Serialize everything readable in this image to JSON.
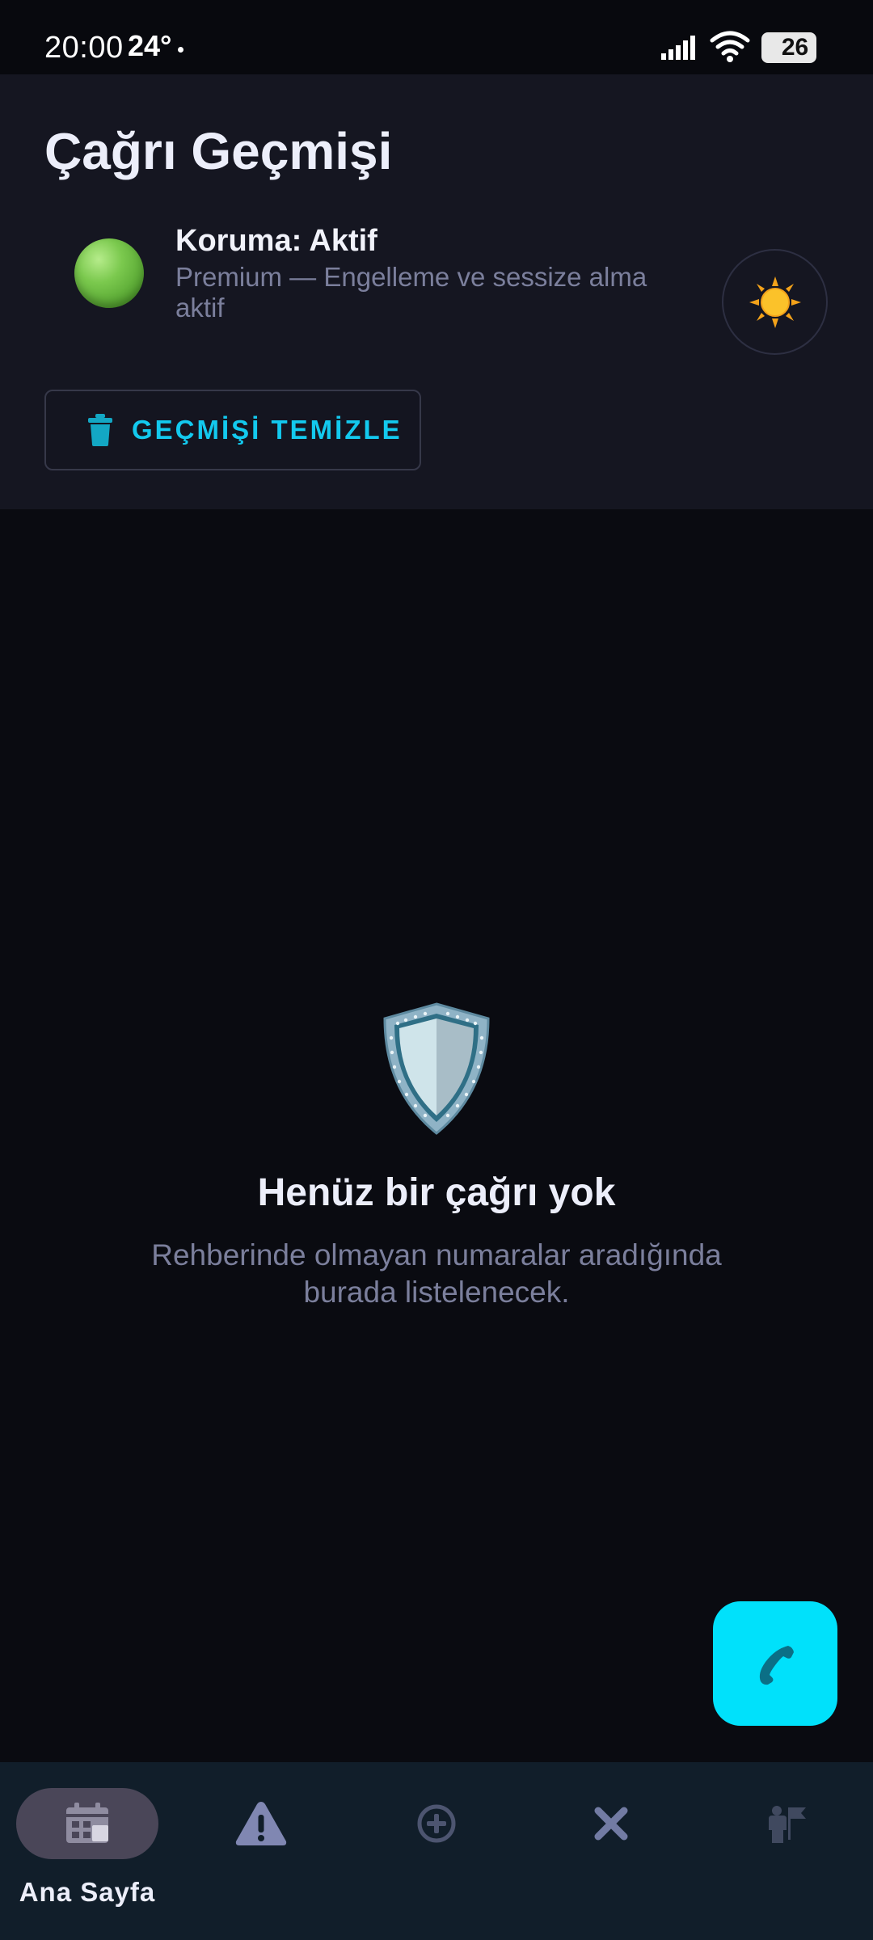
{
  "status_bar": {
    "time": "20:00",
    "temperature": "24°",
    "battery": "26"
  },
  "header": {
    "title": "Çağrı Geçmişi",
    "protection_title": "Koruma: Aktif",
    "protection_subtitle": "Premium — Engelleme ve sessize alma aktif",
    "clear_button_label": "GEÇMİŞİ TEMİZLE"
  },
  "empty_state": {
    "title": "Henüz bir çağrı yok",
    "subtitle": "Rehberinde olmayan numaralar aradığında burada listelenecek."
  },
  "bottom_nav": {
    "items": [
      {
        "label": "Ana Sayfa",
        "icon": "home-calendar-icon",
        "active": true
      },
      {
        "label": "",
        "icon": "warning-icon",
        "active": false
      },
      {
        "label": "",
        "icon": "add-circle-icon",
        "active": false
      },
      {
        "label": "",
        "icon": "close-x-icon",
        "active": false
      },
      {
        "label": "",
        "icon": "profile-icon",
        "active": false
      }
    ]
  },
  "colors": {
    "accent": "#00e1fb",
    "header_bg": "#151621",
    "page_bg": "#0a0b11",
    "nav_bg": "#111e2a",
    "status_green": "#6cc043"
  }
}
